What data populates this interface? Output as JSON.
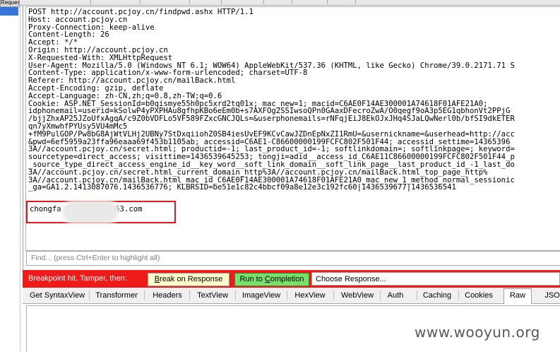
{
  "left_panel": {
    "tab_label": "Request"
  },
  "raw_request": {
    "lines": [
      "POST http://account.pcjoy.cn/findpwd.ashx HTTP/1.1",
      "Host: account.pcjoy.cn",
      "Proxy-Connection: keep-alive",
      "Content-Length: 26",
      "Accept: */*",
      "Origin: http://account.pcjoy.cn",
      "X-Requested-With: XMLHttpRequest",
      "User-Agent: Mozilla/5.0 (Windows NT 6.1; WOW64) AppleWebKit/537.36 (KHTML, like Gecko) Chrome/39.0.2171.71 S",
      "Content-Type: application/x-www-form-urlencoded; charset=UTF-8",
      "Referer: http://account.pcjoy.cn/mailBack.html",
      "Accept-Encoding: gzip, deflate",
      "Accept-Language: zh-CN,zh;q=0.8,zh-TW;q=0.6",
      "Cookie: ASP.NET_SessionId=b0qismye55h0pc5xrd2tq01x; mac_new=1; macid=C6AE0F14AE300001A74618F01AFE21A0;",
      "idphonemail=userid=kSolwP4yPXPHAu8gfhpKBo6eEm0b+s7AXFOg2SSIwsoQPn0GAaxDFecroZwA/O0qegf9oA3p5EG1qbhonVt2PPjG",
      "/bjjZhxAP25JZoUfxAgqA/c9Z0bVDFLo5VF589FZxcGNCJQLs=&userphonemails=rNFqjEiJ8EkOJxJHq4SJaLQwNerl0b/bfSI9dkETER",
      "qn7yXmwhfPYUsy5VU4mMc5",
      "+fM9PulGOP/Pw8bG8AjWtVLHj2UBNy7StDxqiiohZ0SB4iesUvEF9KCvCawJZDnEpNxZI1RmU=&usernickname=&userhead=http://acc",
      "&pwd=6ef5959a23ffa96eaaa69f453b1105ab; accessid=C6AE1-C86600000199FCFC802F501F44; accessid_settime=14365396",
      "3A//account.pcjoy.cn/secret.html; productid=-1; last_product_id=-1; softlinkdomain=; softlinkpage=; keyword=",
      "sourcetype=direct_access; visittime=1436539645253; tongji=adid__access_id_C6AE11C86600000199FCFC802F501F44_p",
      "_source_type_direct_access_engine_id__key_word__soft_link_domain__soft_link_page__last_product_id_-1_last_do",
      "3A//account.pcjoy.cn/secret.html_current_domain_http%3A//account.pcjoy.cn/mailBack.html_top_page_http%",
      "3A//account.pcjoy.cn/mailBack.html_mac_id_C6AE0F14AE300001A74618F01AFE21A0_mac_new_1_method_normal_sessionic",
      "_ga=GA1.2.1413087076.1436536776; KLBRSID=be51e1c82c4bbcf09a8e12e3c192fc60|1436539677|1436536541"
    ],
    "body_text": "chongfa         40163.com"
  },
  "find_bar": {
    "placeholder": "Find... (press Ctrl+Enter to highlight all)"
  },
  "breakpoint_bar": {
    "status": "Breakpoint hit. Tamper, then:",
    "break_on_response": {
      "pre": "",
      "u": "B",
      "post": "reak on Response"
    },
    "run_to_completion": {
      "pre": "Run to ",
      "u": "C",
      "post": "ompletion"
    },
    "choose_response": "Choose Response..."
  },
  "response_tabs": [
    {
      "label": "Get SyntaxView",
      "selected": false
    },
    {
      "label": "Transformer",
      "selected": false
    },
    {
      "label": "Headers",
      "selected": false
    },
    {
      "label": "TextView",
      "selected": false
    },
    {
      "label": "ImageView",
      "selected": false
    },
    {
      "label": "HexView",
      "selected": false
    },
    {
      "label": "WebView",
      "selected": false
    },
    {
      "label": "Auth",
      "selected": false
    },
    {
      "label": "Caching",
      "selected": false
    },
    {
      "label": "Cookies",
      "selected": false
    },
    {
      "label": "Raw",
      "selected": true
    },
    {
      "label": "JSON",
      "selected": false
    }
  ],
  "watermark": "www.wooyun.org",
  "colors": {
    "breakpoint_red": "#ef1b1b",
    "run_green": "#77e06a",
    "break_yellow": "#ffffcc",
    "highlight_box": "#e0191f"
  }
}
